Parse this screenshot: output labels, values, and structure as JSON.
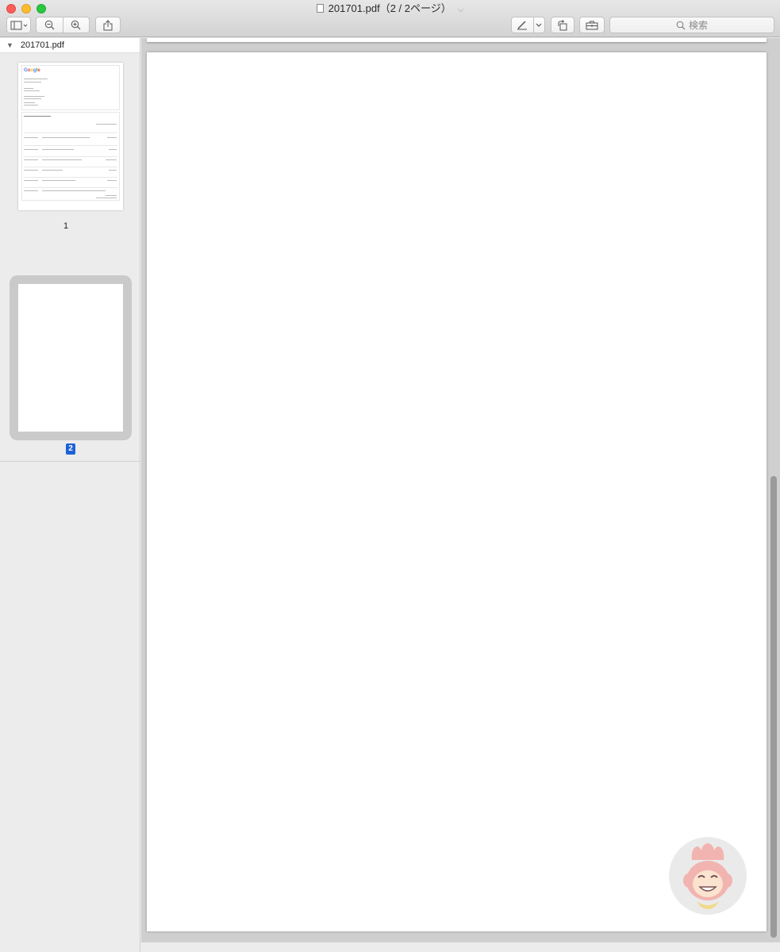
{
  "window": {
    "title": "201701.pdf（2 / 2ページ）"
  },
  "toolbar": {
    "search_placeholder": "検索",
    "icons": [
      "sidebar-toggle-icon",
      "zoom-out-icon",
      "zoom-in-icon",
      "share-icon",
      "markup-pen-icon",
      "rotate-icon",
      "toolbox-icon",
      "search-icon"
    ]
  },
  "sidebar": {
    "file_name": "201701.pdf",
    "pages": [
      {
        "label": "1",
        "selected": false
      },
      {
        "label": "2",
        "selected": true
      }
    ]
  },
  "colors": {
    "selection": "#1d62d6",
    "close": "#fc5f57",
    "minimize": "#fdbc2e",
    "maximize": "#28c840"
  }
}
